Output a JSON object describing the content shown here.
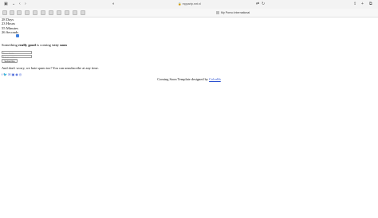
{
  "browser": {
    "url": "mppartp.mrt.nl",
    "tab_label": "My Porno International"
  },
  "countdown": {
    "days": "28 Days",
    "hours": "23 Hours",
    "minutes": "55 Minutes",
    "seconds": "26 Seconds"
  },
  "teaser": {
    "prefix": "Something ",
    "bold1": "really good",
    "middle": " is coming ",
    "bold2": "very soon"
  },
  "form": {
    "name_placeholder": "Your Name",
    "email_placeholder": "Email Address",
    "button_label": "Subscribe"
  },
  "note": "And don't worry, we hate spam too! You can unsubscribe at any time.",
  "social_icons": [
    "facebook-icon",
    "twitter-icon",
    "email-icon",
    "linkedin-icon",
    "google-icon",
    "instagram-icon"
  ],
  "footer": {
    "text": "Coming Soon Template designed by ",
    "link": "Colorlib"
  },
  "colors": {
    "link": "#2a4fd0",
    "accent": "#3d7fe0"
  }
}
